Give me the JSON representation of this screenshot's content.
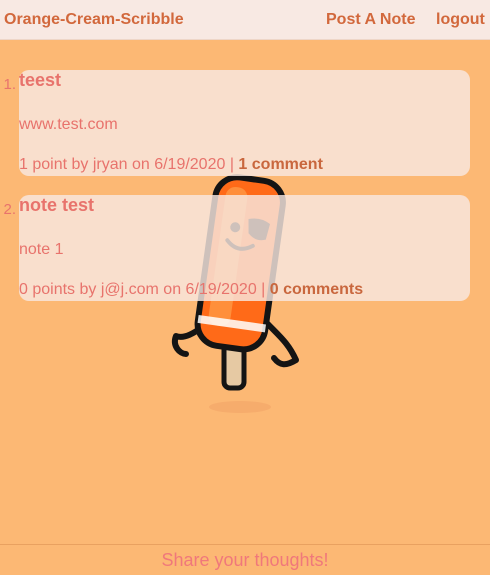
{
  "header": {
    "brand": "Orange-Cream-Scribble",
    "post_link": "Post A Note",
    "logout_link": "logout"
  },
  "notes": [
    {
      "number": "1.",
      "title": "teest",
      "url": "www.test.com",
      "meta": "1 point by jryan on 6/19/2020 | ",
      "comments": "1 comment"
    },
    {
      "number": "2.",
      "title": "note test",
      "url": "note 1",
      "meta": "0 points by j@j.com on 6/19/2020 | ",
      "comments": "0 comments"
    }
  ],
  "footer": {
    "text": "Share your thoughts!"
  },
  "colors": {
    "background": "#fcb874",
    "topbar": "#f8e9e3",
    "brand": "#d2683c",
    "note_text": "#e8736c"
  },
  "mascot": {
    "icon": "popsicle-mascot-icon"
  }
}
